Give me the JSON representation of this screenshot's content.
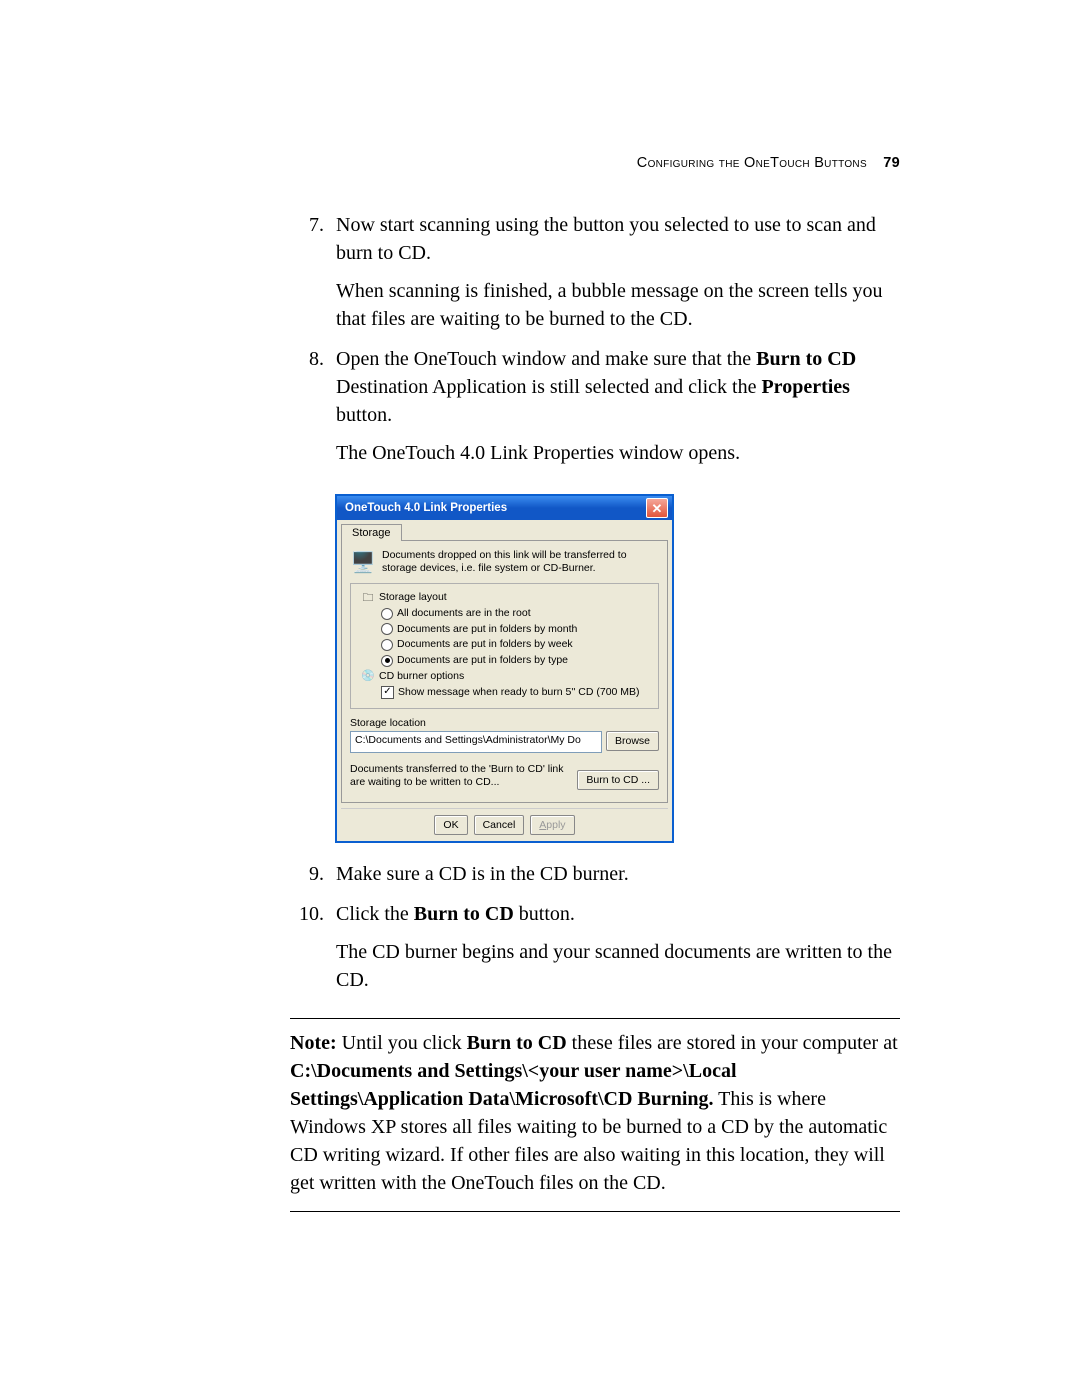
{
  "header": {
    "section_title": "Configuring the OneTouch Buttons",
    "page_number": "79"
  },
  "steps": {
    "s7": {
      "num": "7.",
      "p1": "Now start scanning using the button you selected to use to scan and burn to CD.",
      "p2": "When scanning is finished, a bubble message on the screen tells you that files are waiting to be burned to the CD."
    },
    "s8": {
      "num": "8.",
      "p1a": "Open the OneTouch window and make sure that the ",
      "p1b": "Burn to CD",
      "p1c": " Destination Application is still selected and click the ",
      "p1d": "Properties",
      "p1e": " button.",
      "p2": "The OneTouch 4.0 Link Properties window opens."
    },
    "s9": {
      "num": "9.",
      "p1": "Make sure a CD is in the CD burner."
    },
    "s10": {
      "num": "10.",
      "p1a": "Click the ",
      "p1b": "Burn to CD",
      "p1c": " button.",
      "p2": "The CD burner begins and your scanned documents are written to the CD."
    }
  },
  "dialog": {
    "title": "OneTouch 4.0 Link Properties",
    "tab": "Storage",
    "info": "Documents dropped on this link will be transferred to storage devices, i.e. file system or CD-Burner.",
    "tree": {
      "storage_layout": "Storage layout",
      "r1": "All documents are in the root",
      "r2": "Documents are put in folders by month",
      "r3": "Documents are put in folders by week",
      "r4": "Documents are put in folders by type",
      "cd_options": "CD burner options",
      "cb1": "Show message when ready to burn 5'' CD (700 MB)"
    },
    "location_label": "Storage location",
    "location_value": "C:\\Documents and Settings\\Administrator\\My Do",
    "browse": "Browse",
    "burn_text": "Documents transferred to the 'Burn to CD' link are waiting to be written to CD...",
    "burn_btn": "Burn to CD ...",
    "ok": "OK",
    "cancel": "Cancel",
    "apply_u": "A",
    "apply_rest": "pply"
  },
  "note": {
    "lead": "Note:",
    "t1": "  Until you click ",
    "b1": "Burn to CD",
    "t2": " these files are stored in your computer at ",
    "b2": "C:\\Documents and Settings\\<your user name>\\Local Settings\\Application Data\\Microsoft\\CD Burning.",
    "t3": " This is where Windows XP stores all files waiting to be burned to a CD by the automatic CD writing wizard. If other files are also waiting in this location, they will get written with the OneTouch files on the CD."
  }
}
